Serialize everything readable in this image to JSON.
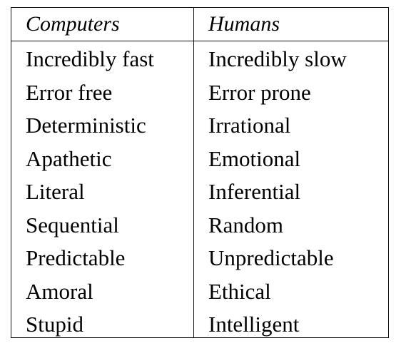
{
  "table": {
    "headers": [
      "Computers",
      "Humans"
    ],
    "rows": [
      [
        "Incredibly fast",
        "Incredibly slow"
      ],
      [
        "Error free",
        "Error prone"
      ],
      [
        "Deterministic",
        "Irrational"
      ],
      [
        "Apathetic",
        "Emotional"
      ],
      [
        "Literal",
        "Inferential"
      ],
      [
        "Sequential",
        "Random"
      ],
      [
        "Predictable",
        "Unpredictable"
      ],
      [
        "Amoral",
        "Ethical"
      ],
      [
        "Stupid",
        "Intelligent"
      ]
    ]
  }
}
